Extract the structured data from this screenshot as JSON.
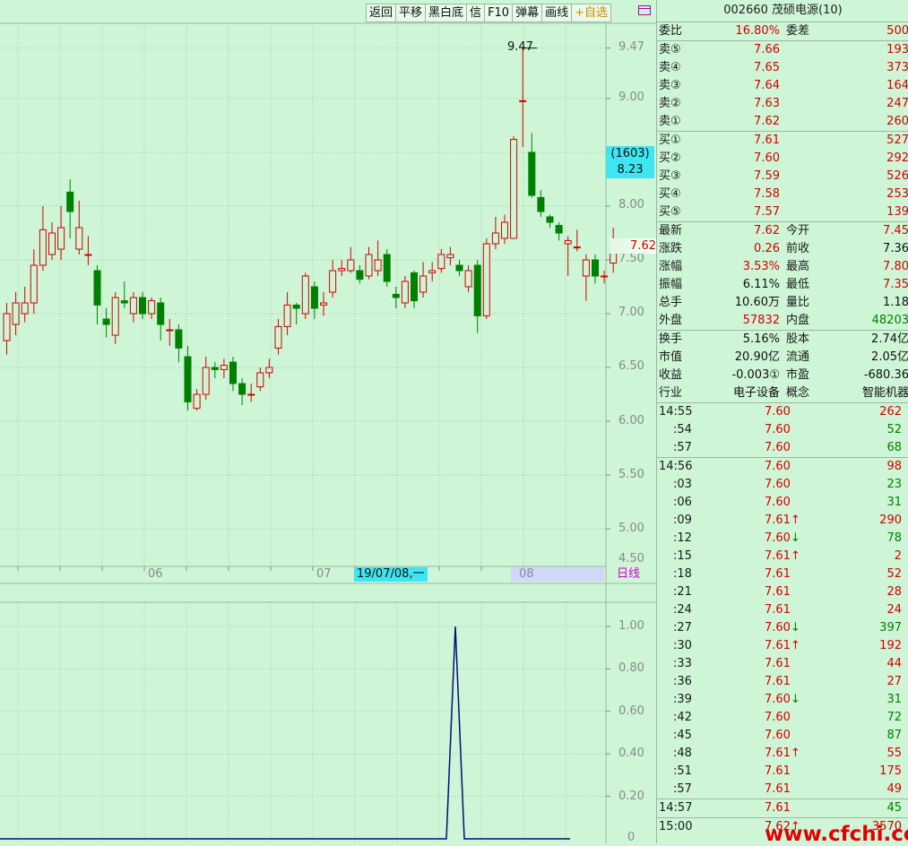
{
  "toolbar": {
    "buttons": [
      "返回",
      "平移",
      "黑白底",
      "信",
      "F10",
      "弹幕",
      "画线"
    ],
    "fav": "+自选"
  },
  "chart_data": {
    "type": "candlestick",
    "period": "日线",
    "y_axis": [
      "9.47",
      "9.00",
      "8.50",
      "8.00",
      "7.50",
      "7.00",
      "6.50",
      "6.00",
      "5.50",
      "5.00",
      "4.50"
    ],
    "ylim": [
      4.5,
      9.6
    ],
    "month_labels": [
      "06",
      "07",
      "08"
    ],
    "highlight_date": "19/07/08,一",
    "high_label": "9.47",
    "crosshair_box": {
      "line1": "(1603)",
      "line2": "8.23"
    },
    "current_price": "7.62",
    "candles": [
      {
        "o": 6.75,
        "c": 7.0,
        "h": 7.1,
        "l": 6.62
      },
      {
        "o": 6.9,
        "c": 7.1,
        "h": 7.2,
        "l": 6.8
      },
      {
        "o": 7.0,
        "c": 7.1,
        "h": 7.25,
        "l": 6.92
      },
      {
        "o": 7.1,
        "c": 7.45,
        "h": 7.6,
        "l": 7.0
      },
      {
        "o": 7.45,
        "c": 7.78,
        "h": 8.0,
        "l": 7.4
      },
      {
        "o": 7.55,
        "c": 7.75,
        "h": 7.85,
        "l": 7.5
      },
      {
        "o": 7.6,
        "c": 7.8,
        "h": 8.0,
        "l": 7.5
      },
      {
        "o": 8.13,
        "c": 7.95,
        "h": 8.25,
        "l": 7.7
      },
      {
        "o": 7.6,
        "c": 7.8,
        "h": 8.05,
        "l": 7.55
      },
      {
        "o": 7.55,
        "c": 7.55,
        "h": 7.72,
        "l": 7.45
      },
      {
        "o": 7.4,
        "c": 7.08,
        "h": 7.45,
        "l": 6.9
      },
      {
        "o": 6.95,
        "c": 6.9,
        "h": 7.05,
        "l": 6.78
      },
      {
        "o": 6.8,
        "c": 7.15,
        "h": 7.2,
        "l": 6.72
      },
      {
        "o": 7.12,
        "c": 7.1,
        "h": 7.3,
        "l": 7.05
      },
      {
        "o": 7.0,
        "c": 7.15,
        "h": 7.2,
        "l": 6.92
      },
      {
        "o": 7.15,
        "c": 7.0,
        "h": 7.2,
        "l": 6.95
      },
      {
        "o": 7.0,
        "c": 7.12,
        "h": 7.15,
        "l": 6.95
      },
      {
        "o": 7.1,
        "c": 6.9,
        "h": 7.15,
        "l": 6.75
      },
      {
        "o": 6.85,
        "c": 6.85,
        "h": 6.95,
        "l": 6.7
      },
      {
        "o": 6.85,
        "c": 6.68,
        "h": 6.9,
        "l": 6.55
      },
      {
        "o": 6.6,
        "c": 6.18,
        "h": 6.7,
        "l": 6.1
      },
      {
        "o": 6.12,
        "c": 6.25,
        "h": 6.3,
        "l": 6.1
      },
      {
        "o": 6.25,
        "c": 6.5,
        "h": 6.6,
        "l": 6.2
      },
      {
        "o": 6.5,
        "c": 6.48,
        "h": 6.55,
        "l": 6.4
      },
      {
        "o": 6.48,
        "c": 6.52,
        "h": 6.58,
        "l": 6.4
      },
      {
        "o": 6.55,
        "c": 6.35,
        "h": 6.6,
        "l": 6.28
      },
      {
        "o": 6.35,
        "c": 6.25,
        "h": 6.4,
        "l": 6.15
      },
      {
        "o": 6.25,
        "c": 6.25,
        "h": 6.35,
        "l": 6.18
      },
      {
        "o": 6.32,
        "c": 6.45,
        "h": 6.5,
        "l": 6.28
      },
      {
        "o": 6.45,
        "c": 6.5,
        "h": 6.58,
        "l": 6.4
      },
      {
        "o": 6.68,
        "c": 6.88,
        "h": 6.95,
        "l": 6.62
      },
      {
        "o": 6.88,
        "c": 7.08,
        "h": 7.2,
        "l": 6.8
      },
      {
        "o": 7.08,
        "c": 7.05,
        "h": 7.1,
        "l": 6.9
      },
      {
        "o": 7.0,
        "c": 7.35,
        "h": 7.38,
        "l": 6.95
      },
      {
        "o": 7.25,
        "c": 7.05,
        "h": 7.3,
        "l": 6.95
      },
      {
        "o": 7.08,
        "c": 7.1,
        "h": 7.2,
        "l": 6.98
      },
      {
        "o": 7.2,
        "c": 7.4,
        "h": 7.5,
        "l": 7.15
      },
      {
        "o": 7.4,
        "c": 7.42,
        "h": 7.5,
        "l": 7.35
      },
      {
        "o": 7.4,
        "c": 7.5,
        "h": 7.62,
        "l": 7.38
      },
      {
        "o": 7.4,
        "c": 7.32,
        "h": 7.45,
        "l": 7.28
      },
      {
        "o": 7.35,
        "c": 7.55,
        "h": 7.62,
        "l": 7.32
      },
      {
        "o": 7.4,
        "c": 7.5,
        "h": 7.68,
        "l": 7.35
      },
      {
        "o": 7.55,
        "c": 7.3,
        "h": 7.6,
        "l": 7.25
      },
      {
        "o": 7.18,
        "c": 7.15,
        "h": 7.25,
        "l": 7.05
      },
      {
        "o": 7.1,
        "c": 7.3,
        "h": 7.35,
        "l": 7.05
      },
      {
        "o": 7.38,
        "c": 7.12,
        "h": 7.4,
        "l": 7.05
      },
      {
        "o": 7.2,
        "c": 7.35,
        "h": 7.48,
        "l": 7.15
      },
      {
        "o": 7.38,
        "c": 7.4,
        "h": 7.48,
        "l": 7.3
      },
      {
        "o": 7.42,
        "c": 7.55,
        "h": 7.6,
        "l": 7.38
      },
      {
        "o": 7.52,
        "c": 7.55,
        "h": 7.62,
        "l": 7.45
      },
      {
        "o": 7.45,
        "c": 7.4,
        "h": 7.5,
        "l": 7.35
      },
      {
        "o": 7.25,
        "c": 7.4,
        "h": 7.45,
        "l": 7.2
      },
      {
        "o": 7.45,
        "c": 6.98,
        "h": 7.5,
        "l": 6.82
      },
      {
        "o": 6.98,
        "c": 7.65,
        "h": 7.7,
        "l": 6.95
      },
      {
        "o": 7.65,
        "c": 7.75,
        "h": 7.9,
        "l": 7.6
      },
      {
        "o": 7.7,
        "c": 7.85,
        "h": 7.92,
        "l": 7.65
      },
      {
        "o": 7.7,
        "c": 8.62,
        "h": 8.65,
        "l": 7.7
      },
      {
        "o": 8.98,
        "c": 8.98,
        "h": 9.47,
        "l": 8.55
      },
      {
        "o": 8.5,
        "c": 8.1,
        "h": 8.68,
        "l": 8.08
      },
      {
        "o": 8.08,
        "c": 7.95,
        "h": 8.15,
        "l": 7.9
      },
      {
        "o": 7.9,
        "c": 7.85,
        "h": 7.92,
        "l": 7.8
      },
      {
        "o": 7.82,
        "c": 7.75,
        "h": 7.85,
        "l": 7.68
      },
      {
        "o": 7.65,
        "c": 7.68,
        "h": 7.72,
        "l": 7.35
      },
      {
        "o": 7.62,
        "c": 7.62,
        "h": 7.78,
        "l": 7.58
      },
      {
        "o": 7.35,
        "c": 7.5,
        "h": 7.55,
        "l": 7.12
      },
      {
        "o": 7.5,
        "c": 7.35,
        "h": 7.55,
        "l": 7.28
      },
      {
        "o": 7.35,
        "c": 7.35,
        "h": 7.4,
        "l": 7.28
      },
      {
        "o": 7.47,
        "c": 7.62,
        "h": 7.8,
        "l": 7.38
      }
    ],
    "indicator": {
      "y_axis": [
        "1.00",
        "0.80",
        "0.60",
        "0.40",
        "0.20",
        "0"
      ],
      "ylim": [
        0,
        1
      ],
      "values": [
        0,
        1,
        0
      ]
    }
  },
  "panel": {
    "title": "002660 茂硕电源(10)",
    "weibi": {
      "label": "委比",
      "value": "16.80%",
      "label2": "委差",
      "value2": "500"
    },
    "sell": [
      {
        "label": "卖⑤",
        "price": "7.66",
        "vol": "193"
      },
      {
        "label": "卖④",
        "price": "7.65",
        "vol": "373"
      },
      {
        "label": "卖③",
        "price": "7.64",
        "vol": "164"
      },
      {
        "label": "卖②",
        "price": "7.63",
        "vol": "247"
      },
      {
        "label": "卖①",
        "price": "7.62",
        "vol": "260"
      }
    ],
    "buy": [
      {
        "label": "买①",
        "price": "7.61",
        "vol": "527"
      },
      {
        "label": "买②",
        "price": "7.60",
        "vol": "292"
      },
      {
        "label": "买③",
        "price": "7.59",
        "vol": "526"
      },
      {
        "label": "买④",
        "price": "7.58",
        "vol": "253"
      },
      {
        "label": "买⑤",
        "price": "7.57",
        "vol": "139"
      }
    ],
    "stats": [
      {
        "l1": "最新",
        "v1": "7.62",
        "c1": "red",
        "l2": "今开",
        "v2": "7.45",
        "c2": "red"
      },
      {
        "l1": "涨跌",
        "v1": "0.26",
        "c1": "red",
        "l2": "前收",
        "v2": "7.36",
        "c2": "blk"
      },
      {
        "l1": "涨幅",
        "v1": "3.53%",
        "c1": "red",
        "l2": "最高",
        "v2": "7.80",
        "c2": "red"
      },
      {
        "l1": "振幅",
        "v1": "6.11%",
        "c1": "blk",
        "l2": "最低",
        "v2": "7.35",
        "c2": "red"
      },
      {
        "l1": "总手",
        "v1": "10.60万",
        "c1": "blk",
        "l2": "量比",
        "v2": "1.18",
        "c2": "blk"
      },
      {
        "l1": "外盘",
        "v1": "57832",
        "c1": "red",
        "l2": "内盘",
        "v2": "48203",
        "c2": "green"
      }
    ],
    "info": [
      {
        "l1": "换手",
        "v1": "5.16%",
        "l2": "股本",
        "v2": "2.74亿"
      },
      {
        "l1": "市值",
        "v1": "20.90亿",
        "l2": "流通",
        "v2": "2.05亿"
      },
      {
        "l1": "收益",
        "v1": "-0.003①",
        "l2": "市盈",
        "v2": "-680.36"
      },
      {
        "l1": "行业",
        "v1": "电子设备",
        "l2": "概念",
        "v2": "智能机器"
      }
    ],
    "ticks": [
      {
        "t": "14:55",
        "min": false,
        "p": "7.60",
        "a": "",
        "v": "262",
        "vc": "red",
        "sep": false
      },
      {
        "t": ":54",
        "min": true,
        "p": "7.60",
        "a": "",
        "v": "52",
        "vc": "green",
        "sep": false
      },
      {
        "t": ":57",
        "min": true,
        "p": "7.60",
        "a": "",
        "v": "68",
        "vc": "green",
        "sep": false
      },
      {
        "t": "14:56",
        "min": false,
        "p": "7.60",
        "a": "",
        "v": "98",
        "vc": "red",
        "sep": true
      },
      {
        "t": ":03",
        "min": true,
        "p": "7.60",
        "a": "",
        "v": "23",
        "vc": "green",
        "sep": false
      },
      {
        "t": ":06",
        "min": true,
        "p": "7.60",
        "a": "",
        "v": "31",
        "vc": "green",
        "sep": false
      },
      {
        "t": ":09",
        "min": true,
        "p": "7.61",
        "a": "↑",
        "v": "290",
        "vc": "red",
        "sep": false
      },
      {
        "t": ":12",
        "min": true,
        "p": "7.60",
        "a": "↓",
        "v": "78",
        "vc": "green",
        "sep": false
      },
      {
        "t": ":15",
        "min": true,
        "p": "7.61",
        "a": "↑",
        "v": "2",
        "vc": "red",
        "sep": false
      },
      {
        "t": ":18",
        "min": true,
        "p": "7.61",
        "a": "",
        "v": "52",
        "vc": "red",
        "sep": false
      },
      {
        "t": ":21",
        "min": true,
        "p": "7.61",
        "a": "",
        "v": "28",
        "vc": "red",
        "sep": false
      },
      {
        "t": ":24",
        "min": true,
        "p": "7.61",
        "a": "",
        "v": "24",
        "vc": "red",
        "sep": false
      },
      {
        "t": ":27",
        "min": true,
        "p": "7.60",
        "a": "↓",
        "v": "397",
        "vc": "green",
        "sep": false
      },
      {
        "t": ":30",
        "min": true,
        "p": "7.61",
        "a": "↑",
        "v": "192",
        "vc": "red",
        "sep": false
      },
      {
        "t": ":33",
        "min": true,
        "p": "7.61",
        "a": "",
        "v": "44",
        "vc": "red",
        "sep": false
      },
      {
        "t": ":36",
        "min": true,
        "p": "7.61",
        "a": "",
        "v": "27",
        "vc": "red",
        "sep": false
      },
      {
        "t": ":39",
        "min": true,
        "p": "7.60",
        "a": "↓",
        "v": "31",
        "vc": "green",
        "sep": false
      },
      {
        "t": ":42",
        "min": true,
        "p": "7.60",
        "a": "",
        "v": "72",
        "vc": "green",
        "sep": false
      },
      {
        "t": ":45",
        "min": true,
        "p": "7.60",
        "a": "",
        "v": "87",
        "vc": "green",
        "sep": false
      },
      {
        "t": ":48",
        "min": true,
        "p": "7.61",
        "a": "↑",
        "v": "55",
        "vc": "red",
        "sep": false
      },
      {
        "t": ":51",
        "min": true,
        "p": "7.61",
        "a": "",
        "v": "175",
        "vc": "red",
        "sep": false
      },
      {
        "t": ":57",
        "min": true,
        "p": "7.61",
        "a": "",
        "v": "49",
        "vc": "red",
        "sep": false
      },
      {
        "t": "14:57",
        "min": false,
        "p": "7.61",
        "a": "",
        "v": "45",
        "vc": "green",
        "sep": true
      },
      {
        "t": "15:00",
        "min": false,
        "p": "7.62",
        "a": "↑",
        "v": "3570",
        "vc": "red",
        "sep": true
      }
    ]
  },
  "watermark": "www.cfchi.com",
  "colors": {
    "up": "#d40000",
    "down": "#008000",
    "bg": "#cdf5d6",
    "grid": "#a8c8ae",
    "line": "#0a0a7a"
  }
}
